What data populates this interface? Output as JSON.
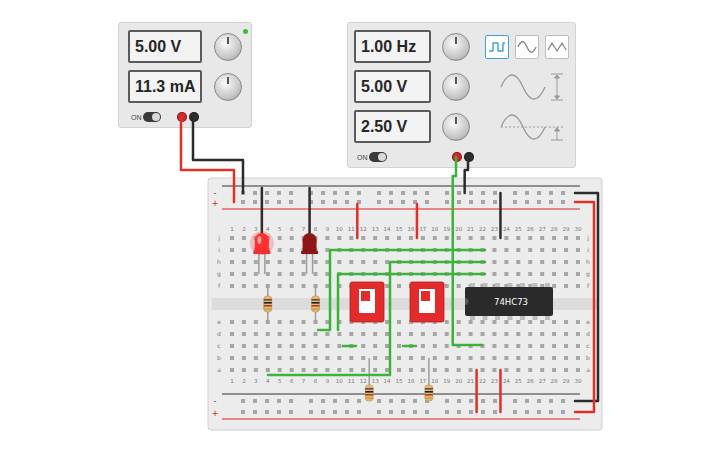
{
  "power_supply": {
    "readouts": [
      "5.00 V",
      "11.3 mA"
    ],
    "switch": {
      "label": "ON",
      "on": true
    },
    "indicator_lit": true
  },
  "function_generator": {
    "readouts": [
      "1.00 Hz",
      "5.00 V",
      "2.50 V"
    ],
    "waveforms": [
      {
        "kind": "square",
        "selected": true
      },
      {
        "kind": "sine",
        "selected": false
      },
      {
        "kind": "triangle",
        "selected": false
      }
    ],
    "switch": {
      "label": "ON",
      "on": true
    }
  },
  "breadboard": {
    "columns": [
      "1",
      "2",
      "3",
      "4",
      "5",
      "6",
      "7",
      "8",
      "9",
      "10",
      "11",
      "12",
      "13",
      "14",
      "15",
      "16",
      "17",
      "18",
      "19",
      "20",
      "21",
      "22",
      "23",
      "24",
      "25",
      "26",
      "27",
      "28",
      "29",
      "30"
    ],
    "row_letters_top": [
      "j",
      "i",
      "h",
      "g",
      "f"
    ],
    "row_letters_bottom": [
      "e",
      "d",
      "c",
      "b",
      "a"
    ],
    "rail_labels": [
      "-",
      "+"
    ]
  },
  "leds": [
    {
      "lit": true,
      "color": "#ff3030"
    },
    {
      "lit": false,
      "color": "#8e1616"
    }
  ],
  "dip_switches": [
    {
      "on": false
    },
    {
      "on": false
    }
  ],
  "chip": {
    "label": "74HC73"
  }
}
